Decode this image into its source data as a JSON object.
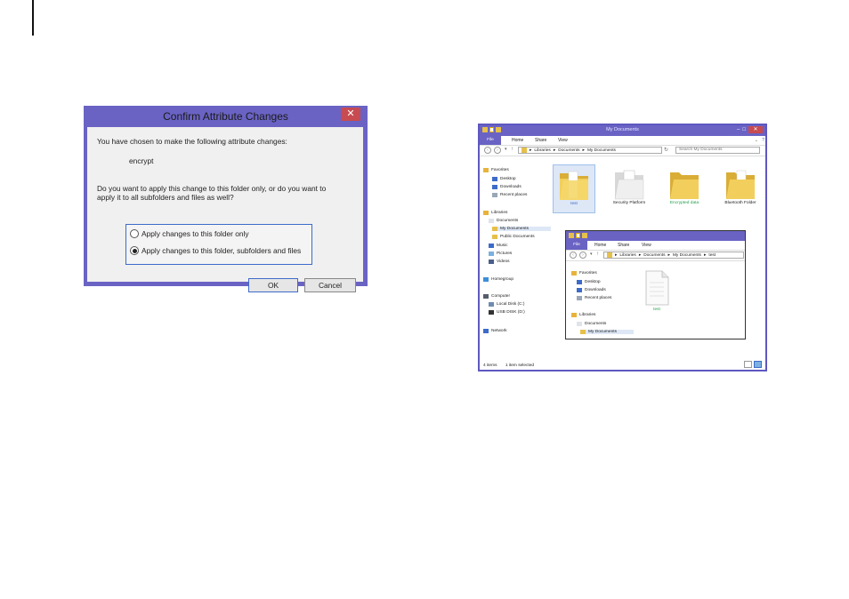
{
  "dialog": {
    "title": "Confirm Attribute Changes",
    "close_glyph": "✕",
    "line1": "You have chosen to make the following attribute changes:",
    "attribute": "encrypt",
    "question_line1": "Do you want to apply this change to this folder only, or do you want to",
    "question_line2": "apply it to all subfolders and files as well?",
    "option_folder_only": "Apply changes to this folder only",
    "option_all": "Apply changes to this folder, subfolders and files",
    "selected_option": "option_all",
    "ok": "OK",
    "cancel": "Cancel"
  },
  "explorer_outer": {
    "title": "My Documents",
    "tabs": [
      "File",
      "Home",
      "Share",
      "View"
    ],
    "path": [
      "Libraries",
      "Documents",
      "My Documents"
    ],
    "search_placeholder": "Search My Documents",
    "nav": {
      "favorites": "Favorites",
      "desktop": "Desktop",
      "downloads": "Downloads",
      "recent": "Recent places",
      "libraries": "Libraries",
      "documents": "Documents",
      "my_documents": "My Documents",
      "public_documents": "Public Documents",
      "music": "Music",
      "pictures": "Pictures",
      "videos": "Videos",
      "homegroup": "Homegroup",
      "computer": "Computer",
      "local_disk": "Local Disk (C:)",
      "usb_disk": "USB DISK (D:)",
      "network": "Network"
    },
    "files": [
      {
        "name": "test",
        "selected": true
      },
      {
        "name": "Security Platform"
      },
      {
        "name": "Encrypted data",
        "encrypted": true
      },
      {
        "name": "Bluetooth Folder"
      }
    ],
    "status_items": "4 items",
    "status_selected": "1 item selected"
  },
  "explorer_inner": {
    "tabs": [
      "File",
      "Home",
      "Share",
      "View"
    ],
    "path": [
      "Libraries",
      "Documents",
      "My Documents",
      "test"
    ],
    "nav": {
      "favorites": "Favorites",
      "desktop": "Desktop",
      "downloads": "Downloads",
      "recent": "Recent places",
      "libraries": "Libraries",
      "documents": "Documents",
      "my_documents": "My Documents"
    },
    "file": "test"
  },
  "colors": {
    "title_bar": "#6a63c4",
    "close_red": "#c74b50",
    "folder_yellow": "#e6c04a",
    "encrypted_green": "#24a04a",
    "selection": "#dde7f6"
  }
}
